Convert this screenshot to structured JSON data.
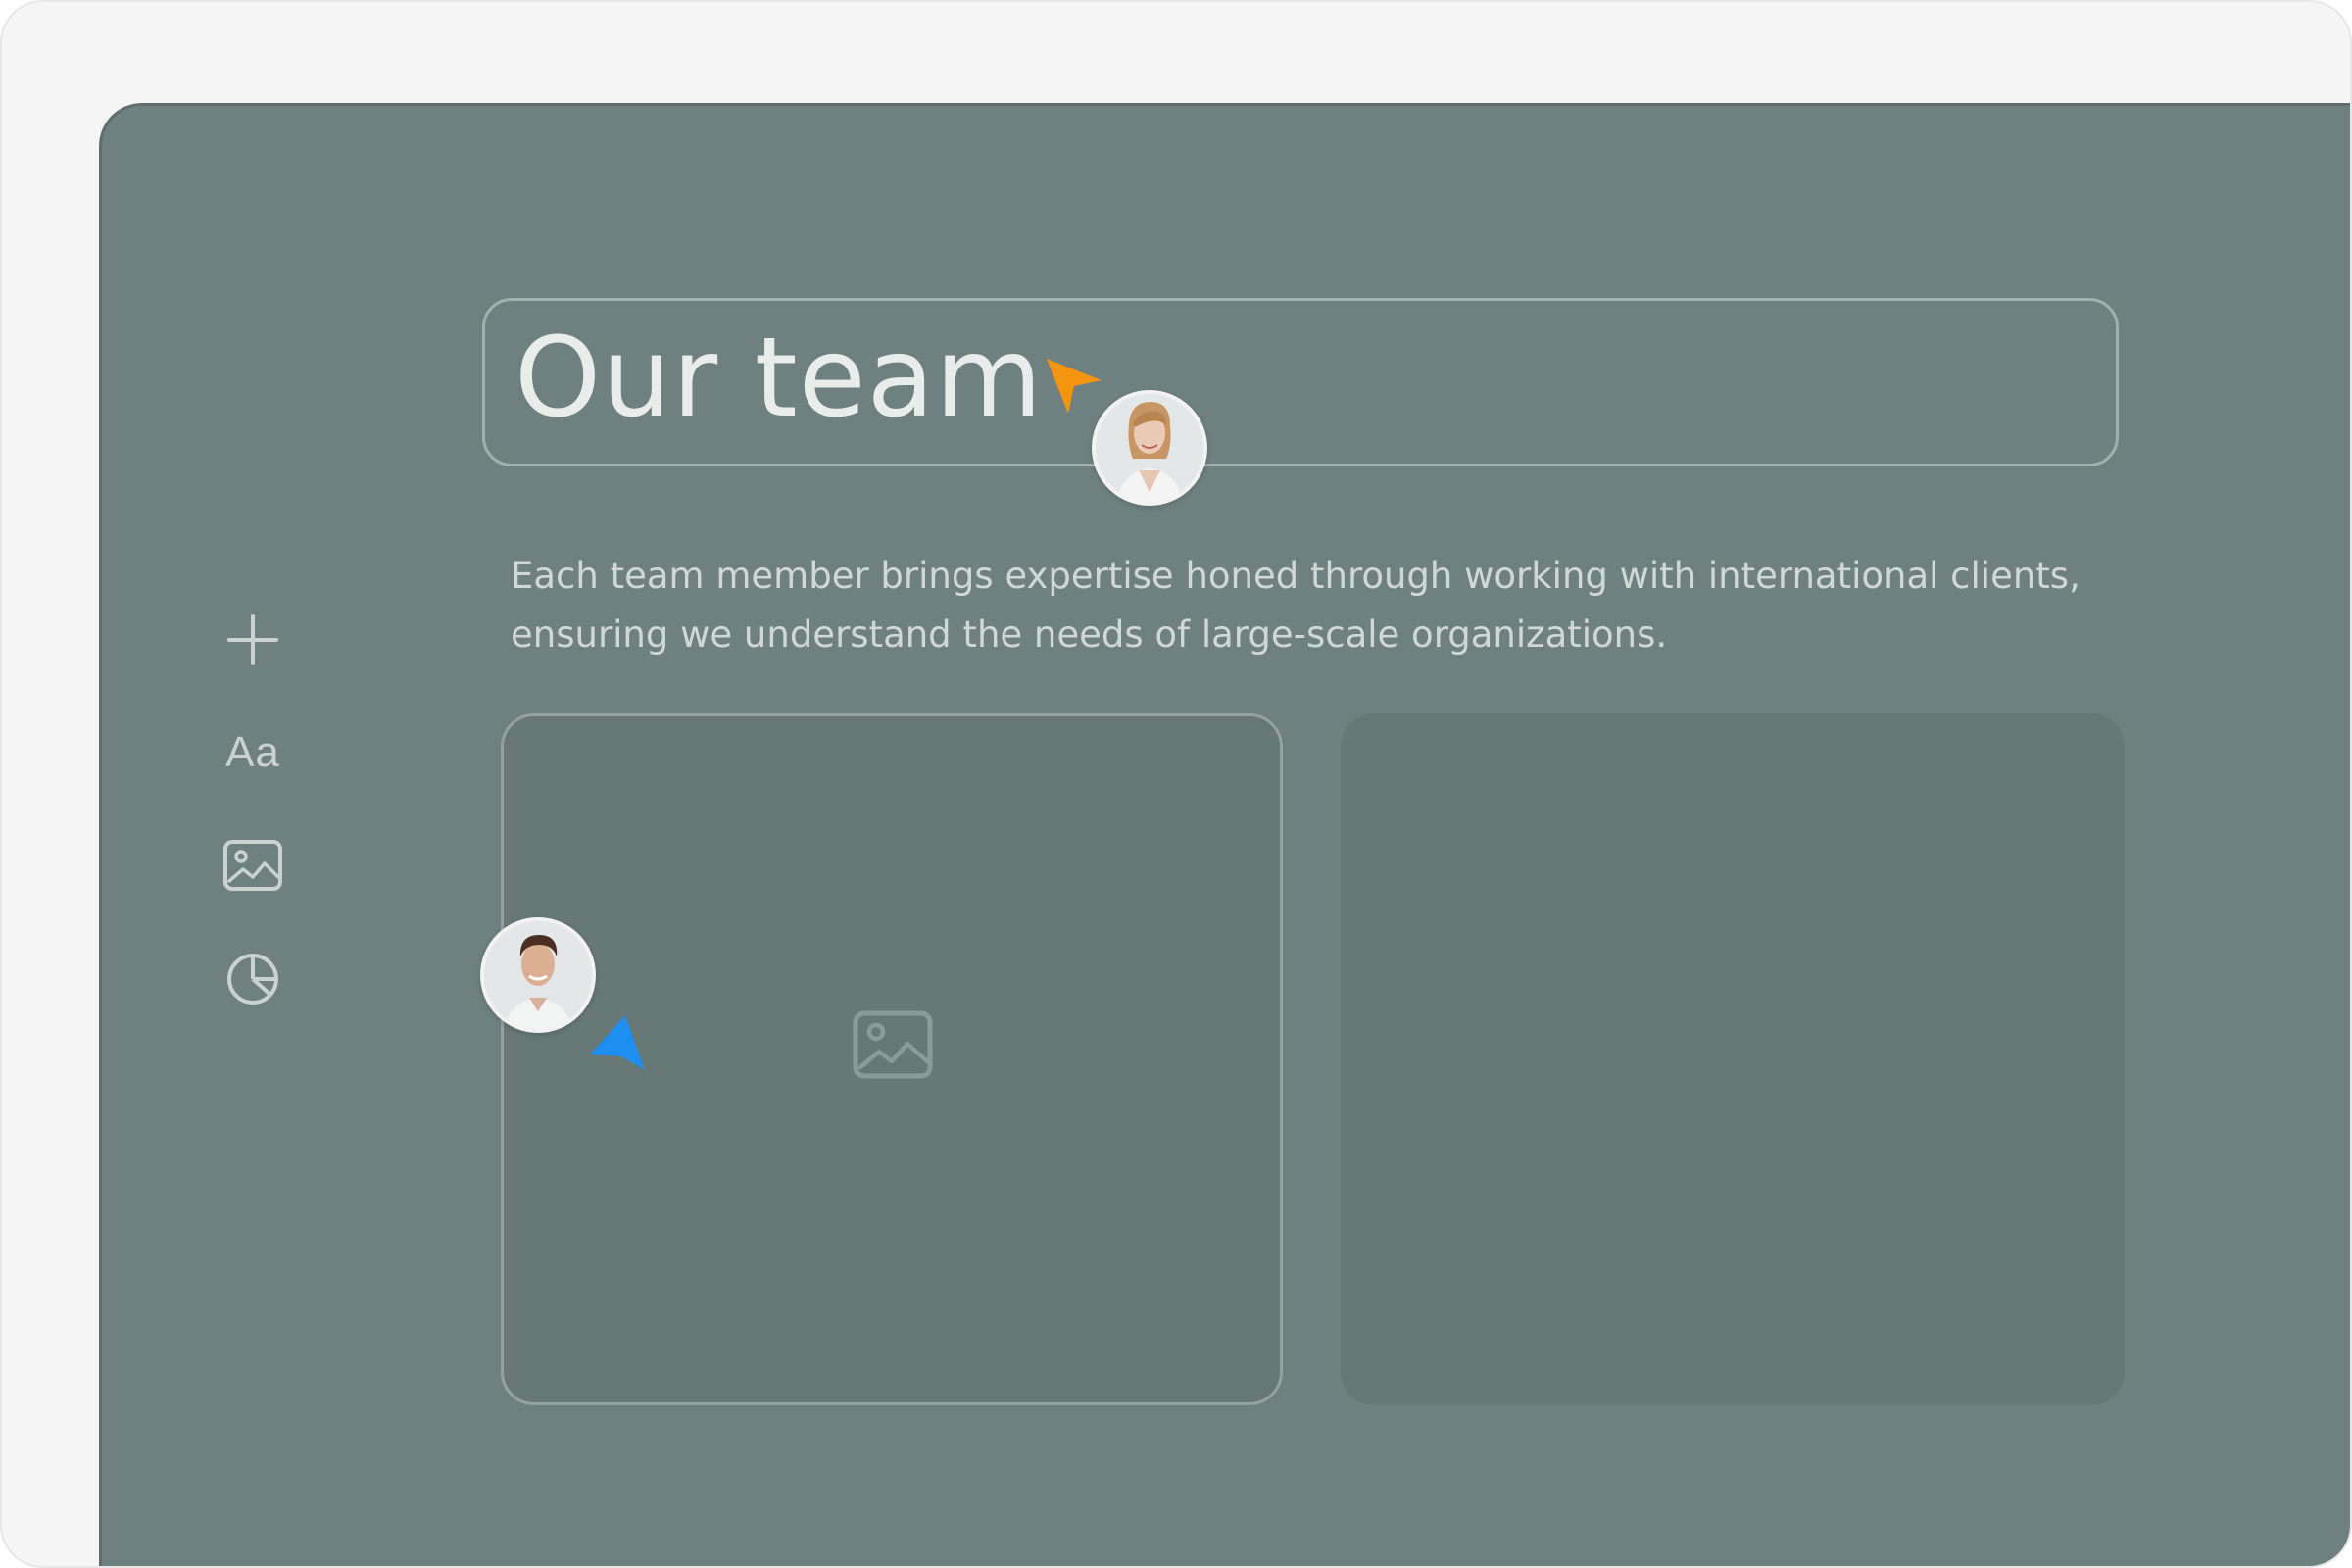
{
  "toolbar": {
    "items": [
      {
        "name": "add",
        "icon": "plus-icon"
      },
      {
        "name": "text",
        "icon": "text-icon",
        "label": "Aa"
      },
      {
        "name": "image",
        "icon": "image-icon"
      },
      {
        "name": "chart",
        "icon": "pie-chart-icon"
      }
    ]
  },
  "slide": {
    "title": "Our team",
    "description_line1": "Each team member brings expertise honed through working with international clients,",
    "description_line2": "ensuring we understand the needs of large-scale organizations."
  },
  "collaborators": [
    {
      "role": "editing-title",
      "cursor_color": "#f5950f",
      "avatar": "woman-avatar"
    },
    {
      "role": "editing-image",
      "cursor_color": "#1e8ff0",
      "avatar": "man-avatar"
    }
  ],
  "colors": {
    "canvas": "#6e807f",
    "card": "#677877",
    "frame": "#f5f5f5"
  }
}
